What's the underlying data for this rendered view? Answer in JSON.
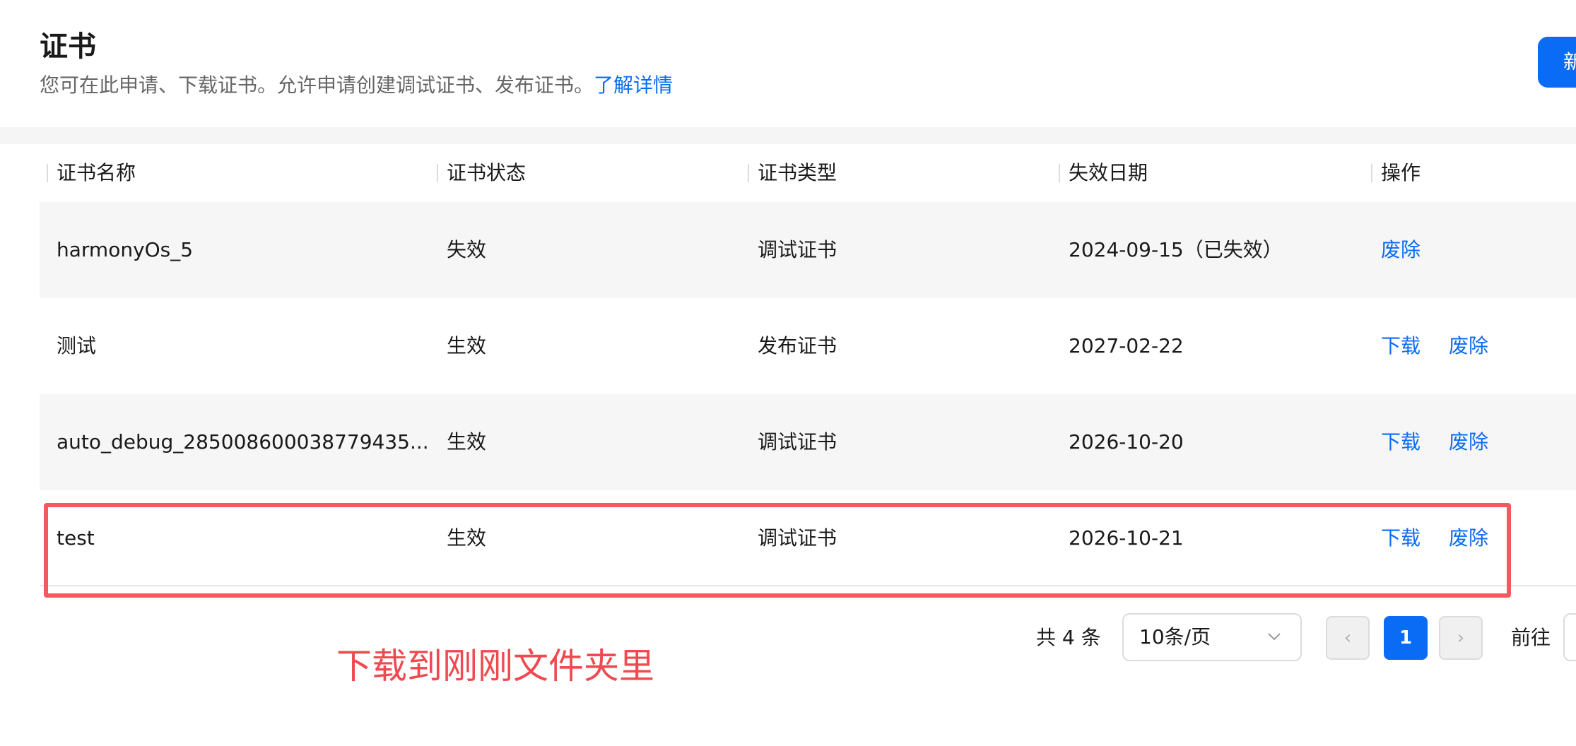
{
  "header": {
    "title": "证书",
    "description": "您可在此申请、下载证书。允许申请创建调试证书、发布证书。",
    "learn_more": "了解详情",
    "new_button": "新"
  },
  "table": {
    "columns": [
      "证书名称",
      "证书状态",
      "证书类型",
      "失效日期",
      "操作"
    ],
    "rows": [
      {
        "name": "harmonyOs_5",
        "status": "失效",
        "type": "调试证书",
        "expiry": "2024-09-15（已失效）",
        "actions": [
          "废除"
        ]
      },
      {
        "name": "测试",
        "status": "生效",
        "type": "发布证书",
        "expiry": "2027-02-22",
        "actions": [
          "下载",
          "废除"
        ]
      },
      {
        "name": "auto_debug_285008600038779435...",
        "status": "生效",
        "type": "调试证书",
        "expiry": "2026-10-20",
        "actions": [
          "下载",
          "废除"
        ]
      },
      {
        "name": "test",
        "status": "生效",
        "type": "调试证书",
        "expiry": "2026-10-21",
        "actions": [
          "下载",
          "废除"
        ]
      }
    ]
  },
  "pagination": {
    "total": "共 4 条",
    "page_size": "10条/页",
    "prev": "‹",
    "current": "1",
    "next": "›",
    "goto_label": "前往"
  },
  "annotation": {
    "text": "下载到刚刚文件夹里",
    "color": "#ee4a4f"
  },
  "colors": {
    "accent": "#0a6cf5",
    "highlight_border": "#f25a5f"
  }
}
